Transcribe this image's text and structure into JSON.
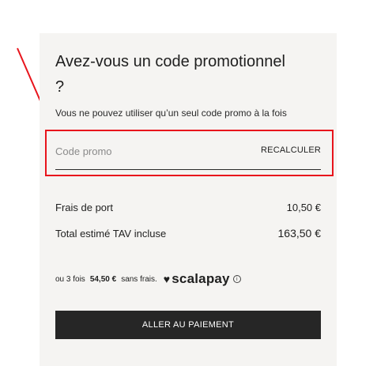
{
  "promo": {
    "title": "Avez-vous un code promotionnel ?",
    "subtitle": "Vous ne pouvez utiliser qu’un seul code promo à la fois",
    "input_placeholder": "Code promo",
    "input_value": "",
    "recalc_label": "RECALCULER"
  },
  "summary": {
    "shipping_label": "Frais de port",
    "shipping_value": "10,50 €",
    "total_label": "Total estimé TAV incluse",
    "total_value": "163,50 €"
  },
  "scalapay": {
    "prefix": "ou 3 fois",
    "amount": "54,50 €",
    "suffix": "sans frais.",
    "brand": "scalapay",
    "heart_icon": "heart-icon",
    "info_icon": "info-icon"
  },
  "checkout": {
    "button_label": "ALLER AU PAIEMENT"
  },
  "colors": {
    "highlight": "#e8141c",
    "panel_bg": "#f5f4f2",
    "button_bg": "#262626"
  }
}
